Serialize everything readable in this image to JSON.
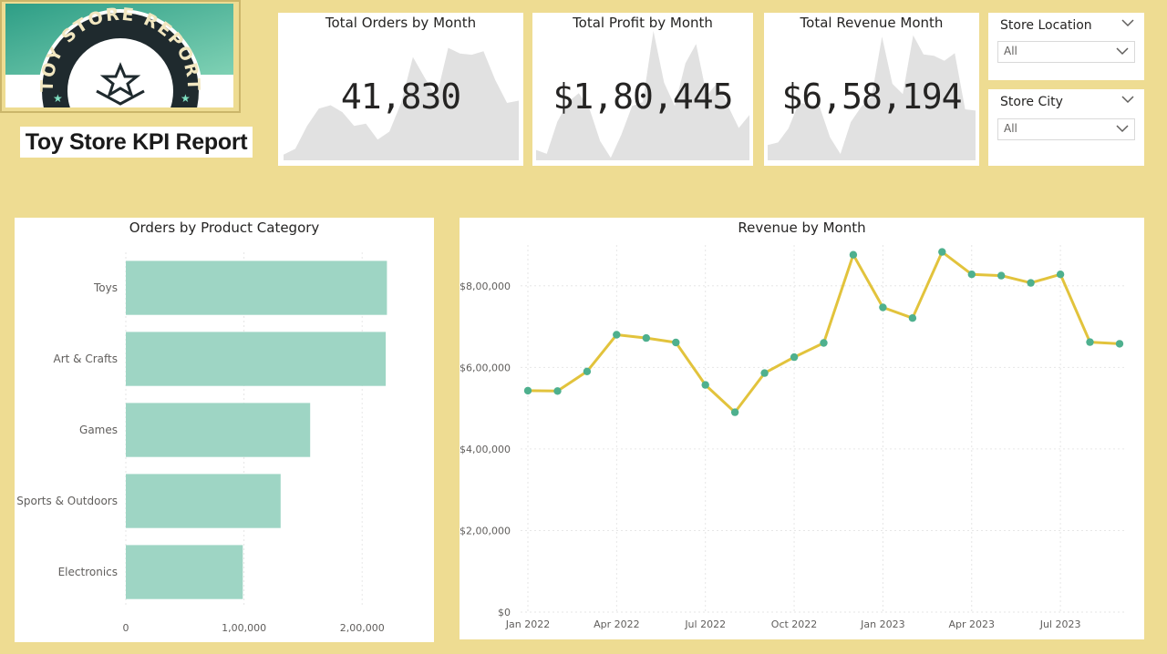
{
  "header": {
    "logo_text": "TOY STORE REPORT",
    "report_title": "Toy Store KPI Report"
  },
  "kpis": [
    {
      "title": "Total Orders by Month",
      "value": "41,830",
      "sparkline": [
        0.05,
        0.1,
        0.3,
        0.45,
        0.48,
        0.42,
        0.3,
        0.32,
        0.18,
        0.25,
        0.5,
        0.9,
        0.72,
        0.55,
        0.98,
        0.93,
        0.92,
        0.95,
        0.7,
        0.5,
        0.52
      ]
    },
    {
      "title": "Total Profit by Month",
      "value": "$1,80,445",
      "sparkline": [
        0.08,
        0.05,
        0.3,
        0.45,
        0.52,
        0.4,
        0.15,
        0.02,
        0.2,
        0.42,
        0.45,
        1.0,
        0.6,
        0.42,
        0.75,
        0.9,
        0.5,
        0.6,
        0.42,
        0.25,
        0.35
      ]
    },
    {
      "title": "Total Revenue Month",
      "value": "$6,58,194",
      "sparkline": [
        0.12,
        0.14,
        0.25,
        0.45,
        0.44,
        0.42,
        0.18,
        0.05,
        0.3,
        0.42,
        0.5,
        0.97,
        0.6,
        0.52,
        0.98,
        0.83,
        0.82,
        0.78,
        0.84,
        0.4,
        0.39
      ]
    }
  ],
  "slicers": [
    {
      "title": "Store Location",
      "value": "All"
    },
    {
      "title": "Store City",
      "value": "All"
    }
  ],
  "icons": {
    "chevron": "chevron-down-icon"
  },
  "colors": {
    "background": "#EEDC92",
    "bar": "#9ED5C4",
    "line": "#E2C33C",
    "marker": "#4EB08E",
    "sparkline": "#E1E1E1"
  },
  "chart_data": [
    {
      "type": "bar",
      "orientation": "horizontal",
      "title": "Orders by Product Category",
      "categories": [
        "Toys",
        "Art & Crafts",
        "Games",
        "Sports & Outdoors",
        "Electronics"
      ],
      "values": [
        221000,
        220000,
        156000,
        131000,
        99000
      ],
      "xlim": [
        0,
        250000
      ],
      "xticks": [
        0,
        100000,
        200000
      ],
      "xtick_labels": [
        "0",
        "1,00,000",
        "2,00,000"
      ],
      "grid": true
    },
    {
      "type": "line",
      "title": "Revenue by Month",
      "x": [
        "Jan 2022",
        "Feb 2022",
        "Mar 2022",
        "Apr 2022",
        "May 2022",
        "Jun 2022",
        "Jul 2022",
        "Aug 2022",
        "Sep 2022",
        "Oct 2022",
        "Nov 2022",
        "Dec 2022",
        "Jan 2023",
        "Feb 2023",
        "Mar 2023",
        "Apr 2023",
        "May 2023",
        "Jun 2023",
        "Jul 2023",
        "Aug 2023",
        "Sep 2023"
      ],
      "xtick_labels": [
        "Jan 2022",
        "Apr 2022",
        "Jul 2022",
        "Oct 2022",
        "Jan 2023",
        "Apr 2023",
        "Jul 2023"
      ],
      "values": [
        543000,
        542000,
        590000,
        680000,
        672000,
        661000,
        557000,
        490000,
        586000,
        625000,
        660000,
        876000,
        747000,
        721000,
        883000,
        828000,
        825000,
        807000,
        828000,
        662000,
        658000
      ],
      "ylim": [
        0,
        900000
      ],
      "yticks": [
        0,
        200000,
        400000,
        600000,
        800000
      ],
      "ytick_labels": [
        "$0",
        "$2,00,000",
        "$4,00,000",
        "$6,00,000",
        "$8,00,000"
      ],
      "grid": true
    }
  ]
}
